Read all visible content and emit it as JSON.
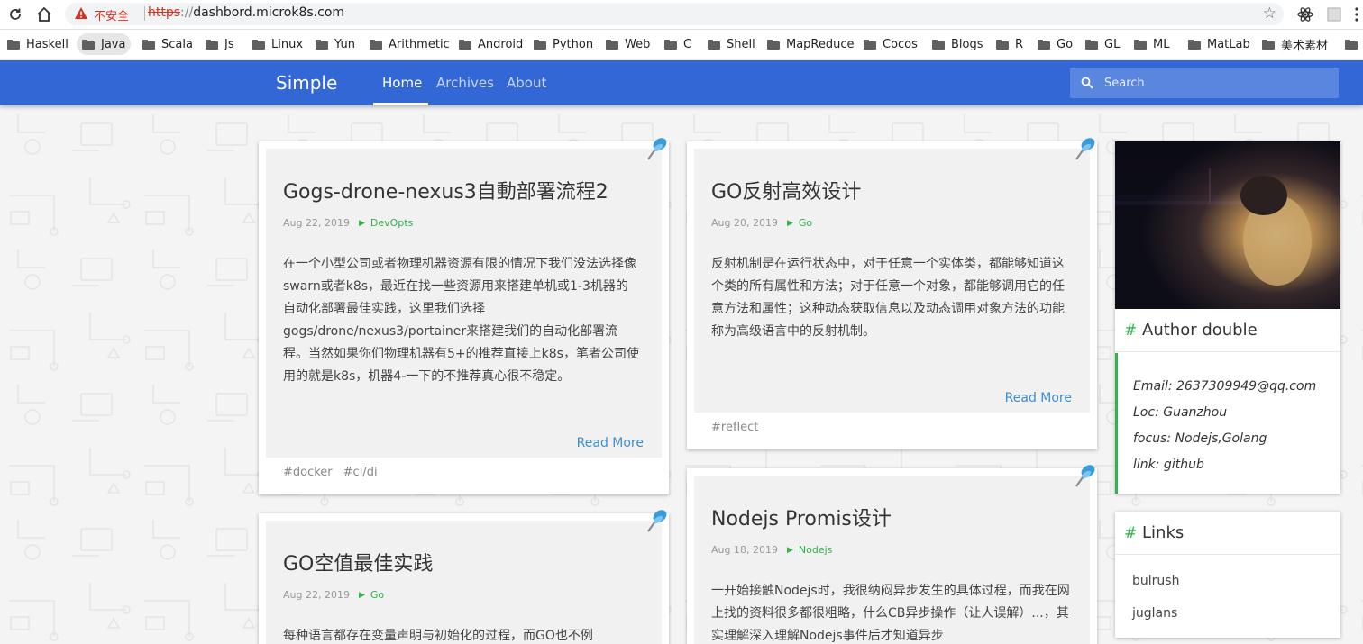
{
  "browser": {
    "insecure_label": "不安全",
    "url_scheme": "https",
    "url_sep": "://",
    "url_host": "dashbord.microk8s.com",
    "bookmarks": [
      "Haskell",
      "Java",
      "Scala",
      "Js",
      "Linux",
      "Yun",
      "Arithmetic",
      "Android",
      "Python",
      "Web",
      "C",
      "Shell",
      "MapReduce",
      "Cocos",
      "Blogs",
      "R",
      "Go",
      "GL",
      "ML",
      "MatLab",
      "美术素材"
    ]
  },
  "site": {
    "brand": "Simple",
    "nav": [
      "Home",
      "Archives",
      "About"
    ],
    "search_placeholder": "Search"
  },
  "posts": [
    {
      "title": "Gogs-drone-nexus3自動部署流程2",
      "date": "Aug 22, 2019",
      "category": "DevOpts",
      "excerpt": "在一个小型公司或者物理机器资源有限的情况下我们没法选择像swarn或者k8s，最近在找一些资源用来搭建单机或1-3机器的自动化部署最佳实践，这里我们选择gogs/drone/nexus3/portainer来搭建我们的自动化部署流程。当然如果你们物理机器有5+的推荐直接上k8s，笔者公司使用的就是k8s，机器4-一下的不推荐真心很不稳定。",
      "read_more": "Read More",
      "tags": [
        "#docker",
        "#ci/di"
      ]
    },
    {
      "title": "GO反射高效设计",
      "date": "Aug 20, 2019",
      "category": "Go",
      "excerpt": "反射机制是在运行状态中，对于任意一个实体类，都能够知道这个类的所有属性和方法；对于任意一个对象，都能够调用它的任意方法和属性；这种动态获取信息以及动态调用对象方法的功能称为高级语言中的反射机制。",
      "read_more": "Read More",
      "tags": [
        "#reflect"
      ]
    },
    {
      "title": "GO空值最佳实践",
      "date": "Aug 22, 2019",
      "category": "Go",
      "excerpt": "每种语言都存在变量声明与初始化的过程，而GO也不例"
    },
    {
      "title": "Nodejs Promis设计",
      "date": "Aug 18, 2019",
      "category": "Nodejs",
      "excerpt": "一开始接触Nodejs时，我很纳闷异步发生的具体过程，而我在网上找的资料很多都很粗略，什么CB异步操作（让人误解）...，其实理解深入理解Nodejs事件后才知道异步"
    }
  ],
  "sidebar": {
    "author": {
      "title": "Author double",
      "email": "Email: 2637309949@qq.com",
      "loc": "Loc: Guanzhou",
      "focus": "focus: Nodejs,Golang",
      "link": "link: github"
    },
    "links": {
      "title": "Links",
      "items": [
        "bulrush",
        "juglans"
      ]
    }
  },
  "colors": {
    "header_bg": "#3367d6",
    "accent_green": "#2fb34a",
    "link_blue": "#3e8ed0"
  }
}
